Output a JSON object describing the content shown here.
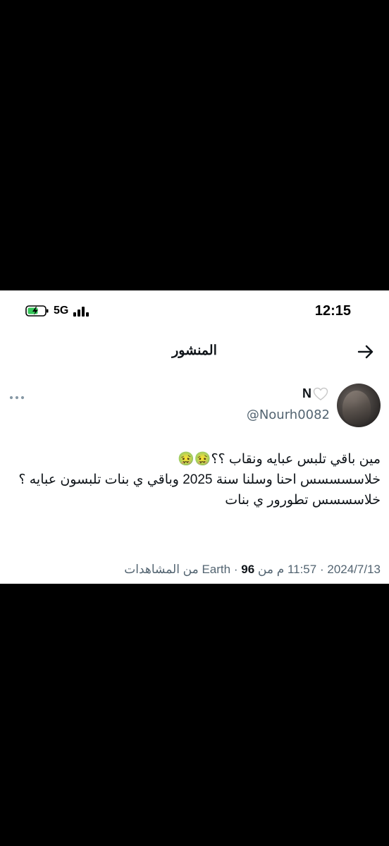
{
  "status_bar": {
    "time": "12:15",
    "network": "5G",
    "battery_icon": "battery-charging-icon",
    "signal_icon": "signal-bars-icon"
  },
  "header": {
    "title": "المنشور",
    "back_icon": "arrow-right-icon"
  },
  "post": {
    "author": {
      "display_name": "N",
      "name_emoji_icon": "white-heart-icon",
      "username": "@Nourh0082"
    },
    "text_lines": [
      "مين باقي تلبس عبايه ونقاب ؟؟🤢🤢",
      "خلاسسسسس احنا وسلنا سنة 2025 وباقي ي بنات تلبسون عبايه ؟",
      "خلاسسسس تطورور ي بنات"
    ],
    "meta": {
      "date": "2024/7/13",
      "time": "11:57 م",
      "location": "من Earth",
      "views_count": "96",
      "views_label": "من المشاهدات",
      "separator": "·"
    }
  },
  "colors": {
    "background": "#000000",
    "panel": "#ffffff",
    "text_primary": "#0f1419",
    "text_secondary": "#536471",
    "battery_green": "#34c759"
  }
}
